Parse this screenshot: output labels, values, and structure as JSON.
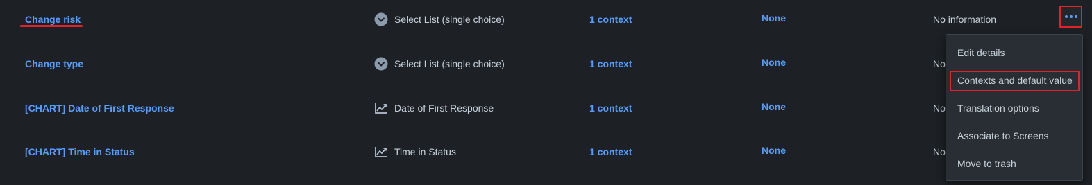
{
  "rows": [
    {
      "name": "Change risk",
      "type_icon": "select-list-icon",
      "type": "Select List (single choice)",
      "contexts": "1 context",
      "screens": "None",
      "info": "No information"
    },
    {
      "name": "Change type",
      "type_icon": "select-list-icon",
      "type": "Select List (single choice)",
      "contexts": "1 context",
      "screens": "None",
      "info": "No"
    },
    {
      "name": "[CHART] Date of First Response",
      "type_icon": "chart-icon",
      "type": "Date of First Response",
      "contexts": "1 context",
      "screens": "None",
      "info": "No"
    },
    {
      "name": "[CHART] Time in Status",
      "type_icon": "chart-icon",
      "type": "Time in Status",
      "contexts": "1 context",
      "screens": "None",
      "info": "No"
    }
  ],
  "more_actions_icon": "more-dots-icon",
  "menu": {
    "items": [
      {
        "label": "Edit details"
      },
      {
        "label": "Contexts and default value"
      },
      {
        "label": "Translation options"
      },
      {
        "label": "Associate to Screens"
      },
      {
        "label": "Move to trash"
      }
    ]
  },
  "colors": {
    "background": "#1d2125",
    "link": "#579dff",
    "highlight_annotation": "#e2222b",
    "menu_background": "#282e33"
  }
}
